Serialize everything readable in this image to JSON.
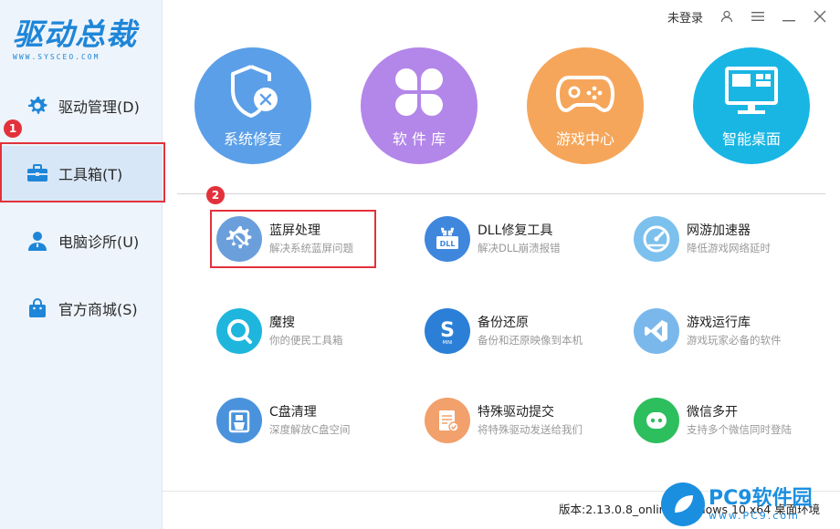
{
  "app": {
    "logo_text": "驱动总裁",
    "logo_sub": "WWW.SYSCEO.COM"
  },
  "topbar": {
    "login": "未登录",
    "icons": [
      "user-icon",
      "menu-icon",
      "minimize-icon",
      "close-icon"
    ]
  },
  "sidebar": {
    "items": [
      {
        "label": "驱动管理(D)",
        "icon": "gear-icon"
      },
      {
        "label": "工具箱(T)",
        "icon": "toolbox-icon"
      },
      {
        "label": "电脑诊所(U)",
        "icon": "doctor-icon"
      },
      {
        "label": "官方商城(S)",
        "icon": "shopping-bag-icon"
      }
    ],
    "active_index": 1
  },
  "badges": [
    "1",
    "2"
  ],
  "features": [
    {
      "label": "系统修复",
      "color": "#5b9fe8"
    },
    {
      "label": "软 件 库",
      "color": "#b386e9"
    },
    {
      "label": "游戏中心",
      "color": "#f5a65b"
    },
    {
      "label": "智能桌面",
      "color": "#19b6e4"
    }
  ],
  "tools": [
    {
      "title": "蓝屏处理",
      "desc": "解决系统蓝屏问题",
      "color": "#6a9fdc"
    },
    {
      "title": "DLL修复工具",
      "desc": "解决DLL崩溃报错",
      "color": "#3f86dd"
    },
    {
      "title": "网游加速器",
      "desc": "降低游戏网络延时",
      "color": "#7cc0ee"
    },
    {
      "title": "魔搜",
      "desc": "你的便民工具箱",
      "color": "#1fb6dd"
    },
    {
      "title": "备份还原",
      "desc": "备份和还原映像到本机",
      "color": "#2c7fd6"
    },
    {
      "title": "游戏运行库",
      "desc": "游戏玩家必备的软件",
      "color": "#7ab8ec"
    },
    {
      "title": "C盘清理",
      "desc": "深度解放C盘空间",
      "color": "#4a93dc"
    },
    {
      "title": "特殊驱动提交",
      "desc": "将特殊驱动发送给我们",
      "color": "#f2a06c"
    },
    {
      "title": "微信多开",
      "desc": "支持多个微信同时登陆",
      "color": "#2dbe5e"
    }
  ],
  "footer": {
    "version": "版本:2.13.0.8_online  Windows 10 x64 桌面环境"
  },
  "watermark": {
    "main": "PC9软件园",
    "sub": "www.PC9.com"
  }
}
